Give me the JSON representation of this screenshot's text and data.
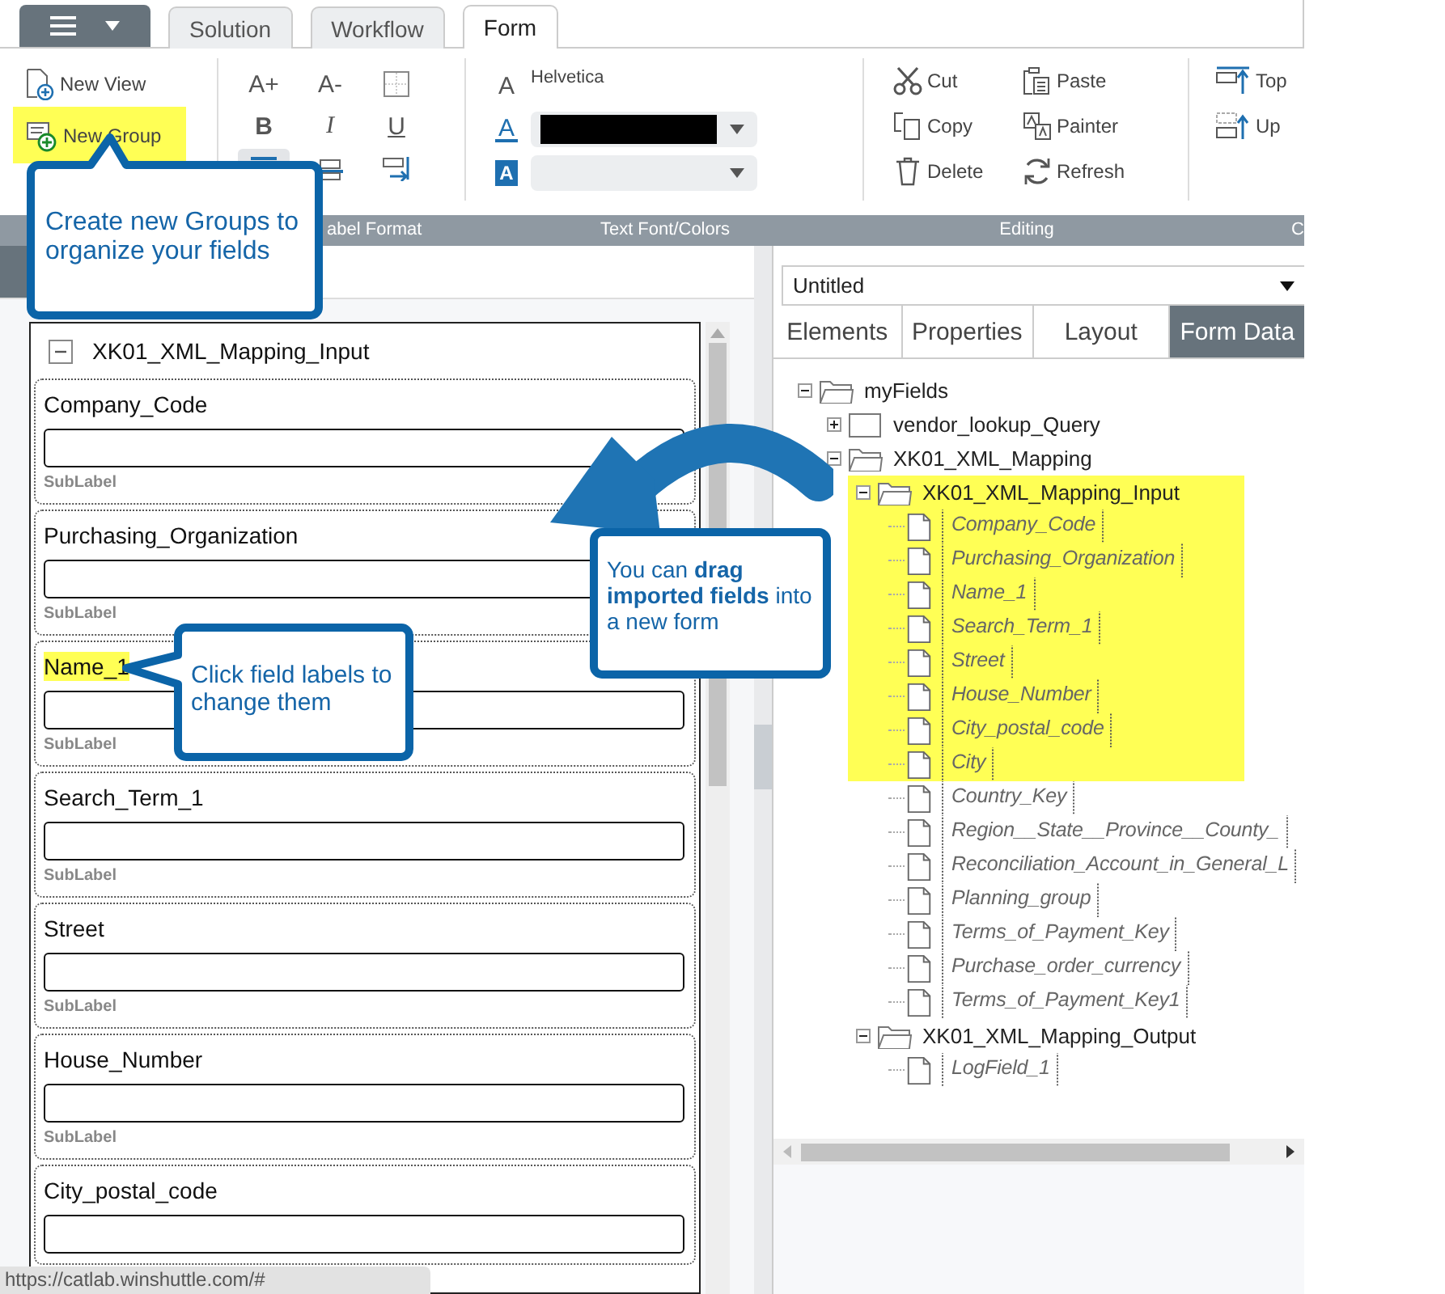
{
  "top_tabs": [
    {
      "label": "Solution",
      "selected": false
    },
    {
      "label": "Workflow",
      "selected": false
    },
    {
      "label": "Form",
      "selected": true
    }
  ],
  "ribbon": {
    "views": [
      {
        "label": "New View",
        "kind": "new-view",
        "highlighted": false
      },
      {
        "label": "New Group",
        "kind": "new-group",
        "highlighted": true
      }
    ],
    "label_format": {
      "grow": "A+",
      "shrink": "A-",
      "bold": "B",
      "italic": "I",
      "underline": "U",
      "align": [
        {
          "selected": true
        },
        {
          "selected": false
        },
        {
          "selected": false
        }
      ]
    },
    "text_font": {
      "font_icon": "A",
      "font_name": "Helvetica",
      "color_icon": "A",
      "fill_icon": "A"
    },
    "editing": [
      {
        "label": "Cut",
        "kind": "cut"
      },
      {
        "label": "Copy",
        "kind": "copy"
      },
      {
        "label": "Delete",
        "kind": "delete"
      },
      {
        "label": "Paste",
        "kind": "paste"
      },
      {
        "label": "Painter",
        "kind": "painter"
      },
      {
        "label": "Refresh",
        "kind": "refresh"
      }
    ],
    "order": [
      {
        "label": "Top",
        "kind": "top"
      },
      {
        "label": "Up",
        "kind": "up"
      }
    ],
    "group_labels": [
      "abel Format",
      "Text Font/Colors",
      "Editing",
      "C"
    ]
  },
  "form_group": {
    "title": "XK01_XML_Mapping_Input",
    "expanded": true,
    "fields": [
      {
        "label": "Company_Code",
        "sublabel": "SubLabel",
        "highlighted": false
      },
      {
        "label": "Purchasing_Organization",
        "sublabel": "SubLabel",
        "highlighted": false
      },
      {
        "label": "Name_1",
        "sublabel": "SubLabel",
        "highlighted": true
      },
      {
        "label": "Search_Term_1",
        "sublabel": "SubLabel",
        "highlighted": false
      },
      {
        "label": "Street",
        "sublabel": "SubLabel",
        "highlighted": false
      },
      {
        "label": "House_Number",
        "sublabel": "SubLabel",
        "highlighted": false
      },
      {
        "label": "City_postal_code",
        "highlighted": false
      }
    ]
  },
  "right_panel": {
    "form_select": "Untitled",
    "tabs": [
      {
        "label": "Elements",
        "selected": false
      },
      {
        "label": "Properties",
        "selected": false
      },
      {
        "label": "Layout",
        "selected": false
      },
      {
        "label": "Form Data",
        "selected": true
      }
    ],
    "tree": [
      {
        "label": "myFields",
        "kind": "folder",
        "expanded": true,
        "highlighted": false,
        "children": [
          {
            "label": "vendor_lookup_Query",
            "kind": "folder",
            "expanded": false,
            "highlighted": false
          },
          {
            "label": "XK01_XML_Mapping",
            "kind": "folder",
            "expanded": true,
            "highlighted": false,
            "children": [
              {
                "label": "XK01_XML_Mapping_Input",
                "kind": "folder",
                "expanded": true,
                "highlighted": true,
                "children": [
                  {
                    "label": "Company_Code",
                    "kind": "field",
                    "highlighted": true
                  },
                  {
                    "label": "Purchasing_Organization",
                    "kind": "field",
                    "highlighted": true
                  },
                  {
                    "label": "Name_1",
                    "kind": "field",
                    "highlighted": true
                  },
                  {
                    "label": "Search_Term_1",
                    "kind": "field",
                    "highlighted": true
                  },
                  {
                    "label": "Street",
                    "kind": "field",
                    "highlighted": true
                  },
                  {
                    "label": "House_Number",
                    "kind": "field",
                    "highlighted": true
                  },
                  {
                    "label": "City_postal_code",
                    "kind": "field",
                    "highlighted": true
                  },
                  {
                    "label": "City",
                    "kind": "field",
                    "highlighted": true
                  },
                  {
                    "label": "Country_Key",
                    "kind": "field",
                    "highlighted": false
                  },
                  {
                    "label": "Region__State__Province__County_",
                    "kind": "field",
                    "highlighted": false
                  },
                  {
                    "label": "Reconciliation_Account_in_General_L",
                    "kind": "field",
                    "highlighted": false
                  },
                  {
                    "label": "Planning_group",
                    "kind": "field",
                    "highlighted": false
                  },
                  {
                    "label": "Terms_of_Payment_Key",
                    "kind": "field",
                    "highlighted": false
                  },
                  {
                    "label": "Purchase_order_currency",
                    "kind": "field",
                    "highlighted": false
                  },
                  {
                    "label": "Terms_of_Payment_Key1",
                    "kind": "field",
                    "highlighted": false
                  }
                ]
              },
              {
                "label": "XK01_XML_Mapping_Output",
                "kind": "folder",
                "expanded": true,
                "highlighted": false,
                "children": [
                  {
                    "label": "LogField_1",
                    "kind": "field",
                    "highlighted": false
                  }
                ]
              }
            ]
          }
        ]
      }
    ]
  },
  "callouts": [
    {
      "text": "Create new Groups to organize your fields"
    },
    {
      "text": "Click field labels to change them"
    },
    {
      "text": "You can **drag imported fields** into a new form"
    }
  ],
  "status_bar": {
    "url": "https://catlab.winshuttle.com/#"
  }
}
